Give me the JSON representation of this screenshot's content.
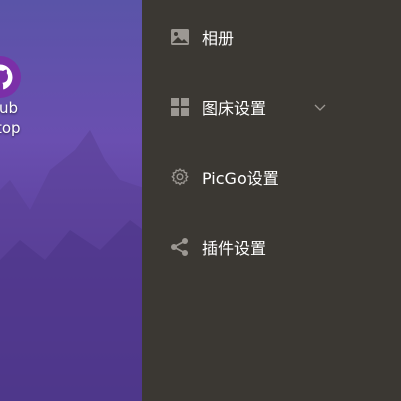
{
  "desktop": {
    "icon_label_line1": "tHub",
    "icon_label_line2": "sktop",
    "icon": "github-icon"
  },
  "sidebar": {
    "items": [
      {
        "label": "相册",
        "icon": "image-icon"
      },
      {
        "label": "图床设置",
        "icon": "grid-icon",
        "expandable": true
      },
      {
        "label": "PicGo设置",
        "icon": "gear-icon"
      },
      {
        "label": "插件设置",
        "icon": "share-icon"
      }
    ]
  },
  "colors": {
    "sidebar_bg": "#3b3833",
    "icon_color": "#9c9893",
    "text_color": "#ffffff",
    "wallpaper_purple": "#5a44a0"
  }
}
